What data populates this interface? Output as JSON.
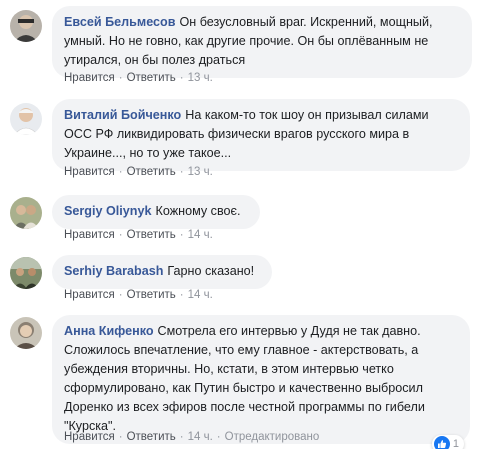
{
  "comments": [
    {
      "author": "Евсей Бельмесов",
      "text": "Он безусловный враг. Искренний, мощный, умный. Но не говно, как другие прочие. Он бы оплёванным не утирался, он бы полез драться",
      "like": "Нравится",
      "reply": "Ответить",
      "time": "13 ч."
    },
    {
      "author": "Виталий Бойченко",
      "text": "На каком-то ток шоу он призывал силами ОСС РФ ликвидировать физически врагов русского мира в Украине..., но то уже такое...",
      "like": "Нравится",
      "reply": "Ответить",
      "time": "13 ч."
    },
    {
      "author": "Sergiy Oliynyk",
      "text": "Кожному своє.",
      "like": "Нравится",
      "reply": "Ответить",
      "time": "14 ч."
    },
    {
      "author": "Serhiy Barabash",
      "text": "Гарно сказано!",
      "like": "Нравится",
      "reply": "Ответить",
      "time": "14 ч."
    },
    {
      "author": "Анна Кифенко",
      "text": "Смотрела его интервью у Дудя не так давно. Сложилось впечатление, что ему главное - актерствовать, а убеждения вторичны. Но, кстати, в этом интервью четко сформулировано, как Путин быстро и качественно выбросил Доренко из всех эфиров после честной программы по гибели \"Курска\".",
      "like": "Нравится",
      "reply": "Ответить",
      "time": "14 ч.",
      "edited": "Отредактировано",
      "reaction_count": "1"
    }
  ],
  "separator": "·",
  "colors": {
    "author": "#385898",
    "bubble": "#f2f3f5",
    "action_link": "#4b4f56",
    "meta": "#90949c",
    "like_badge": "#1877f2"
  },
  "icons": {
    "reaction": "thumbs-up-icon"
  }
}
